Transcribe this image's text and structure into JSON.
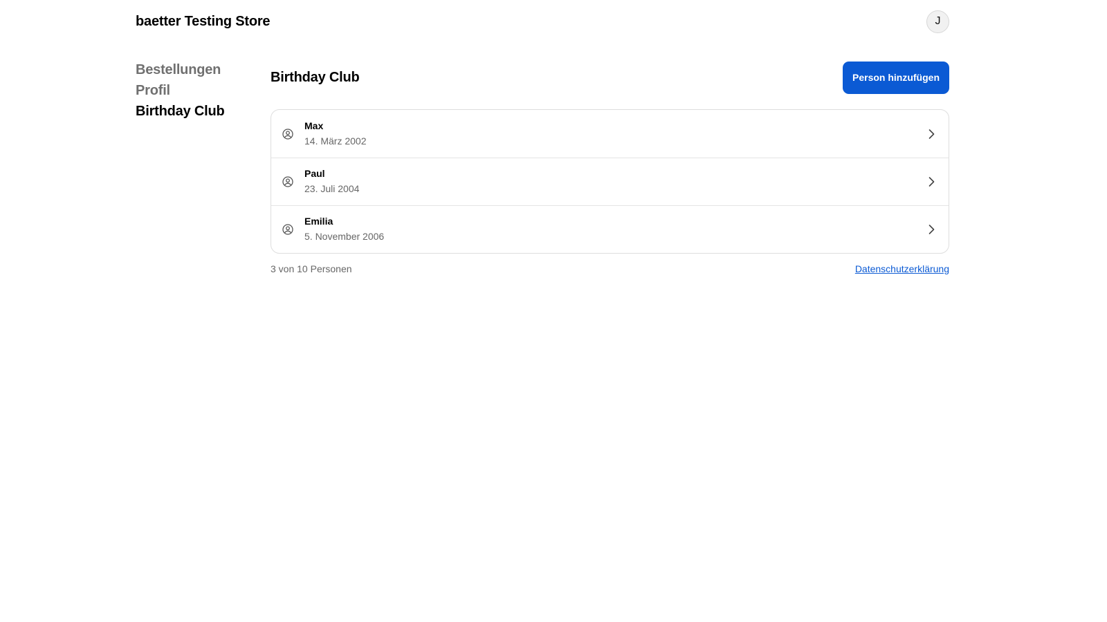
{
  "header": {
    "store_title": "baetter Testing Store",
    "avatar_initial": "J"
  },
  "sidebar": {
    "items": [
      {
        "label": "Bestellungen",
        "active": false
      },
      {
        "label": "Profil",
        "active": false
      },
      {
        "label": "Birthday Club",
        "active": true
      }
    ]
  },
  "main": {
    "title": "Birthday Club",
    "add_button_label": "Person hinzufügen",
    "people": [
      {
        "name": "Max",
        "date": "14. März 2002"
      },
      {
        "name": "Paul",
        "date": "23. Juli 2004"
      },
      {
        "name": "Emilia",
        "date": "5. November 2006"
      }
    ],
    "count_text": "3 von 10 Personen",
    "privacy_link": "Datenschutzerklärung"
  },
  "icons": {
    "person": "user-circle-icon",
    "chevron": "chevron-right-icon"
  },
  "colors": {
    "accent": "#0b5ad4",
    "muted_text": "#666666",
    "nav_inactive": "#707070"
  }
}
